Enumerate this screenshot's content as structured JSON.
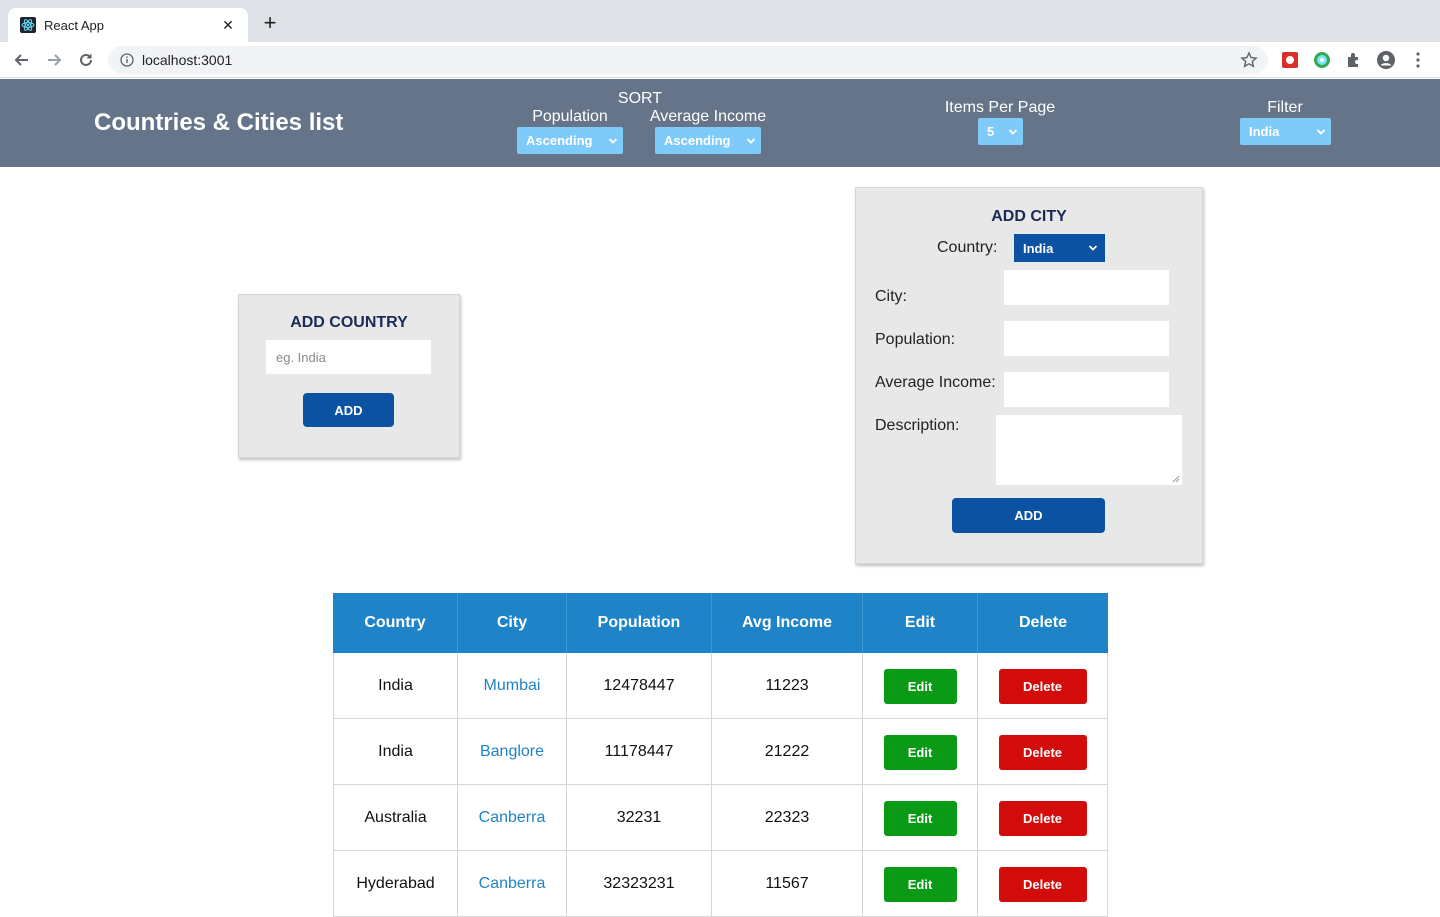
{
  "browser": {
    "tab_title": "React App",
    "url": "localhost:3001"
  },
  "header": {
    "title": "Countries & Cities list",
    "sort_label": "SORT",
    "population_label": "Population",
    "population_value": "Ascending",
    "income_label": "Average Income",
    "income_value": "Ascending",
    "items_per_page_label": "Items Per Page",
    "items_per_page_value": "5",
    "filter_label": "Filter",
    "filter_value": "India"
  },
  "add_country": {
    "title": "ADD COUNTRY",
    "placeholder": "eg. India",
    "button": "ADD"
  },
  "add_city": {
    "title": "ADD CITY",
    "country_label": "Country:",
    "country_value": "India",
    "city_label": "City:",
    "population_label": "Population:",
    "income_label": "Average Income:",
    "description_label": "Description:",
    "button": "ADD"
  },
  "table": {
    "headers": [
      "Country",
      "City",
      "Population",
      "Avg Income",
      "Edit",
      "Delete"
    ],
    "edit_label": "Edit",
    "delete_label": "Delete",
    "rows": [
      {
        "country": "India",
        "city": "Mumbai",
        "population": "12478447",
        "income": "11223"
      },
      {
        "country": "India",
        "city": "Banglore",
        "population": "11178447",
        "income": "21222"
      },
      {
        "country": "Australia",
        "city": "Canberra",
        "population": "32231",
        "income": "22323"
      },
      {
        "country": "Hyderabad",
        "city": "Canberra",
        "population": "32323231",
        "income": "11567"
      }
    ]
  },
  "colors": {
    "header_bg": "#657489",
    "select_bg": "#7ecbfa",
    "primary": "#0c52a3",
    "table_header": "#1f84c7",
    "edit": "#0a9a16",
    "delete": "#d20b0b"
  }
}
